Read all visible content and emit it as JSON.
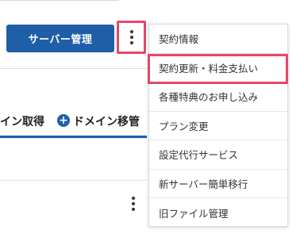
{
  "toolbar": {
    "server_button_label": "サーバー管理",
    "more_icon": "kebab-vertical-icon"
  },
  "tabs": {
    "tab1_label": "イン取得",
    "tab2_label": "ドメイン移管",
    "tab2_icon": "plus-circle-icon"
  },
  "menu": {
    "items": [
      {
        "label": "契約情報"
      },
      {
        "label": "契約更新・料金支払い"
      },
      {
        "label": "各種特典のお申し込み"
      },
      {
        "label": "プラン変更"
      },
      {
        "label": "設定代行サービス"
      },
      {
        "label": "新サーバー簡単移行"
      },
      {
        "label": "旧ファイル管理"
      }
    ],
    "highlighted_index": 1
  },
  "colors": {
    "accent": "#1f5fa8",
    "highlight": "#e5476b"
  }
}
